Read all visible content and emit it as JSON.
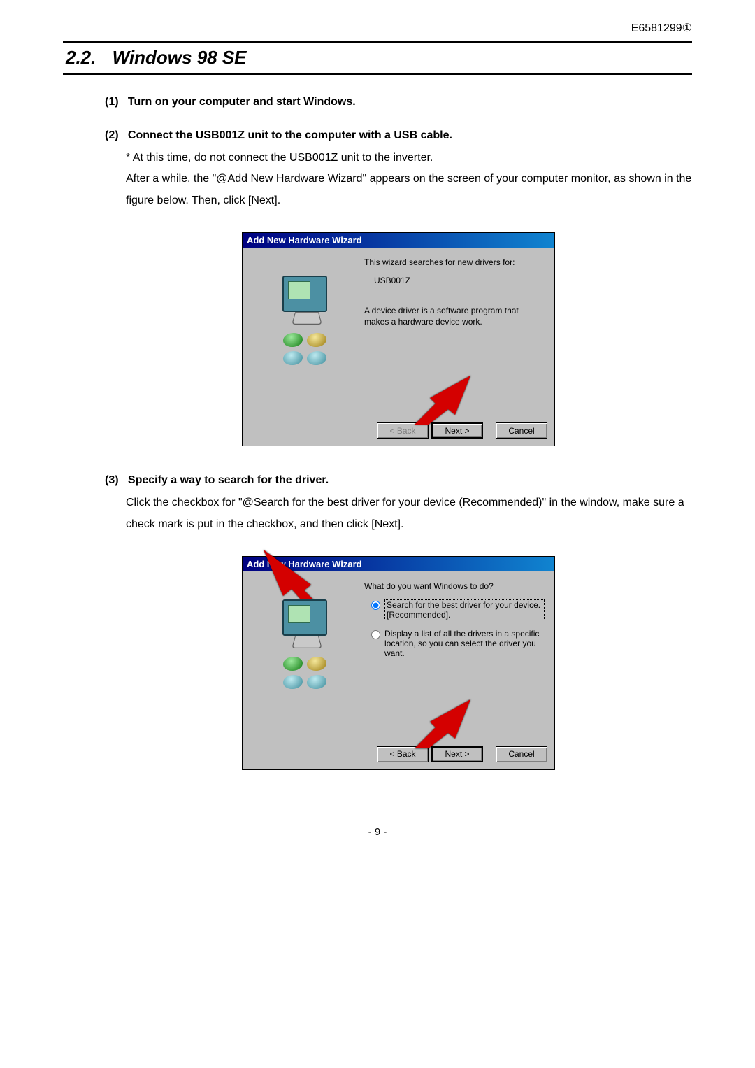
{
  "doc_id": "E6581299①",
  "section": {
    "number": "2.2.",
    "title": "Windows 98 SE"
  },
  "steps": [
    {
      "num": "(1)",
      "title": "Turn on your computer and start Windows.",
      "body": []
    },
    {
      "num": "(2)",
      "title": "Connect the USB001Z unit to the computer with a USB cable.",
      "body": [
        "* At this time, do not connect the USB001Z unit to the inverter.",
        "After a while, the \"@Add New Hardware Wizard\" appears on the screen of your computer monitor, as shown in the figure below. Then, click [Next]."
      ]
    },
    {
      "num": "(3)",
      "title": "Specify a way to search for the driver.",
      "body": [
        "Click the checkbox for \"@Search for the best driver for your device (Recommended)\" in the window, make sure a check mark is put in the checkbox, and then click [Next]."
      ]
    }
  ],
  "wizard1": {
    "title": "Add New Hardware Wizard",
    "line1": "This wizard searches for new drivers for:",
    "device": "USB001Z",
    "desc": "A device driver is a software program that makes a hardware device work.",
    "back": "< Back",
    "next": "Next >",
    "cancel": "Cancel"
  },
  "wizard2": {
    "title": "Add New Hardware Wizard",
    "question": "What do you want Windows to do?",
    "opt1": "Search for the best driver for your device. [Recommended].",
    "opt2": "Display a list of all the drivers in a specific location, so you can select the driver you want.",
    "back": "< Back",
    "next": "Next >",
    "cancel": "Cancel"
  },
  "page_number": "- 9 -"
}
